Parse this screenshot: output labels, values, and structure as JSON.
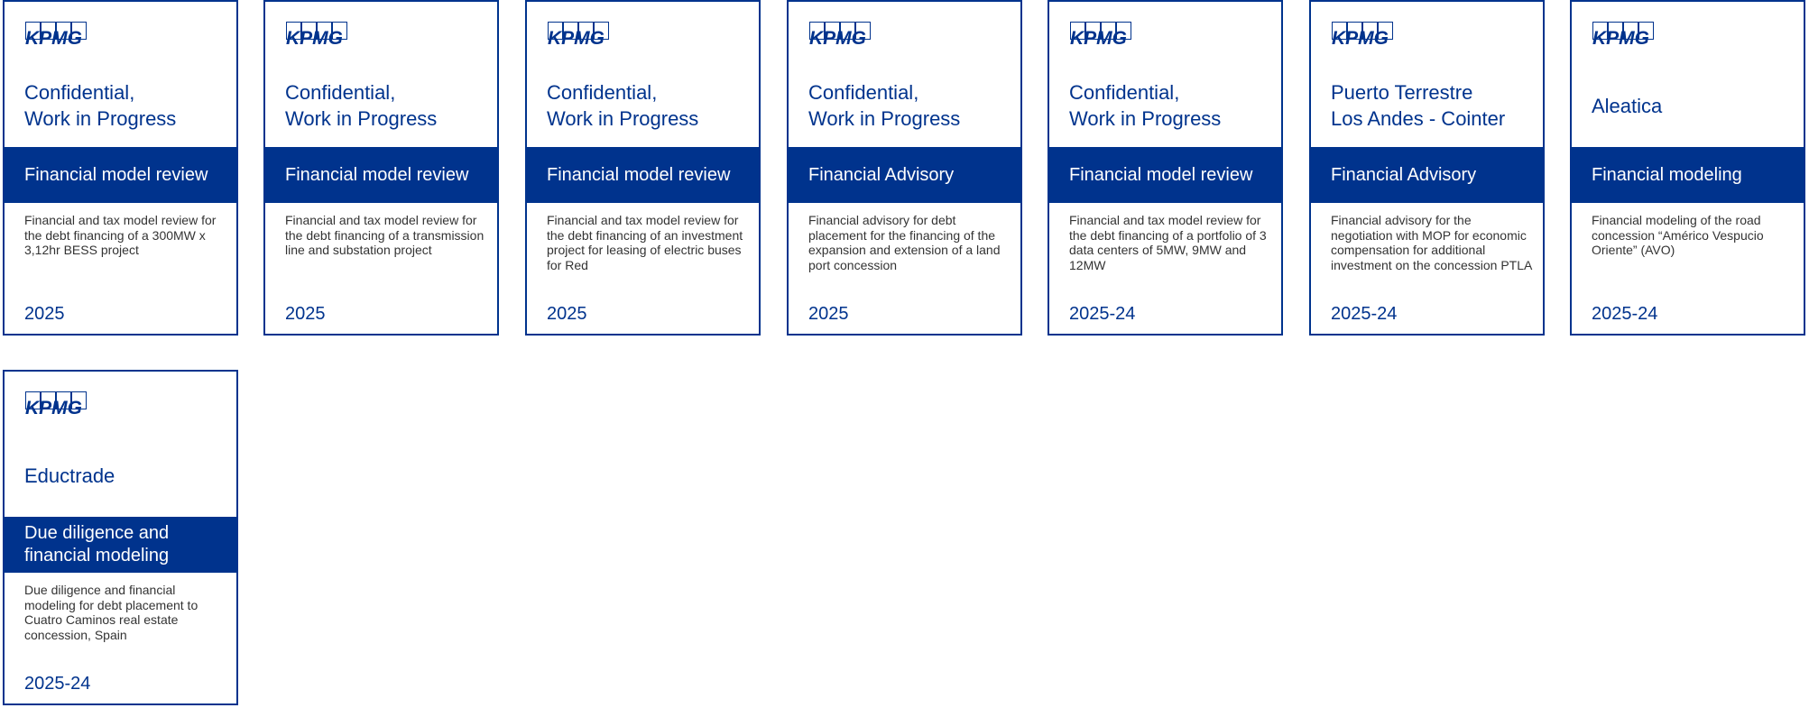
{
  "brand": {
    "logo_text": "KPMG",
    "primary_color": "#00338d",
    "text_color": "#333333"
  },
  "cards": [
    {
      "client": "Confidential,\nWork in Progress",
      "service": "Financial model review",
      "description": "Financial and tax model review for the debt financing of a 300MW x 3,12hr BESS project",
      "year": "2025"
    },
    {
      "client": "Confidential,\nWork in Progress",
      "service": "Financial model review",
      "description": "Financial and tax model review for the debt financing of a transmission line and substation project",
      "year": "2025"
    },
    {
      "client": "Confidential,\nWork in Progress",
      "service": "Financial model review",
      "description": "Financial and tax model review for the debt financing of an investment project for leasing of electric buses for Red",
      "year": "2025"
    },
    {
      "client": "Confidential,\nWork in Progress",
      "service": "Financial Advisory",
      "description": "Financial advisory for debt placement for the financing of the expansion and extension of a land port concession",
      "year": "2025"
    },
    {
      "client": "Confidential,\nWork in Progress",
      "service": "Financial model review",
      "description": "Financial and tax model review for the debt financing of a portfolio of 3 data centers of 5MW, 9MW and 12MW",
      "year": "2025-24"
    },
    {
      "client": "Puerto Terrestre\nLos Andes - Cointer",
      "service": "Financial Advisory",
      "description": "Financial advisory for the negotiation with MOP for economic compensation for additional investment on the concession PTLA",
      "year": "2025-24"
    },
    {
      "client": "Aleatica",
      "service": "Financial modeling",
      "description": "Financial modeling of the road concession “Américo Vespucio Oriente” (AVO)",
      "year": "2025-24"
    },
    {
      "client": "Eductrade",
      "service": "Due diligence and\nfinancial modeling",
      "description": "Due diligence and financial modeling for debt placement to Cuatro Caminos real estate concession, Spain",
      "year": "2025-24"
    }
  ]
}
